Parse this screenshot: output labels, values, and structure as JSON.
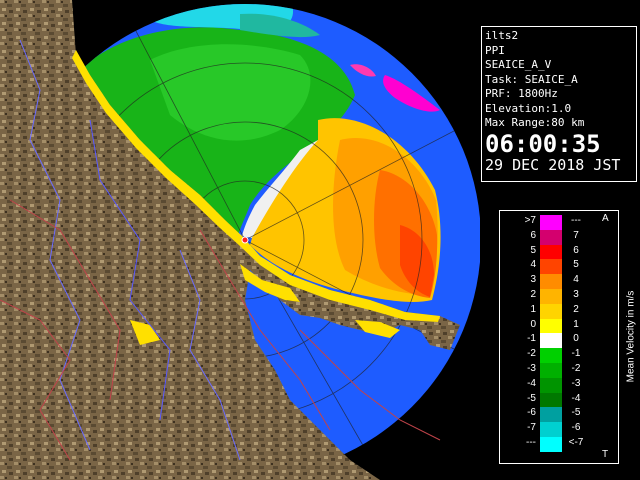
{
  "info": {
    "radar": "ilts2",
    "product": "PPI",
    "scan": "SEAICE_A_V",
    "task": "Task: SEAICE_A",
    "prf": "PRF: 1800Hz",
    "elevation": "Elevation:1.0",
    "max_range": "Max Range:80 km",
    "time": "06:00:35",
    "date": "29 DEC 2018 JST"
  },
  "legend": {
    "title": "Mean Velocity in m/s",
    "top_mark": "A",
    "bottom_mark": "T",
    "rows": [
      {
        "left": ">7",
        "right": "---",
        "color": "#ff00ff"
      },
      {
        "left": "6",
        "right": "7",
        "color": "#d4006e"
      },
      {
        "left": "5",
        "right": "6",
        "color": "#ff0000"
      },
      {
        "left": "4",
        "right": "5",
        "color": "#ff4400"
      },
      {
        "left": "3",
        "right": "4",
        "color": "#ff8c00"
      },
      {
        "left": "2",
        "right": "3",
        "color": "#ffb400"
      },
      {
        "left": "1",
        "right": "2",
        "color": "#ffd400"
      },
      {
        "left": "0",
        "right": "1",
        "color": "#ffff00"
      },
      {
        "left": "-1",
        "right": "0",
        "color": "#ffffff"
      },
      {
        "left": "-2",
        "right": "-1",
        "color": "#00d000"
      },
      {
        "left": "-3",
        "right": "-2",
        "color": "#00b000"
      },
      {
        "left": "-4",
        "right": "-3",
        "color": "#009400"
      },
      {
        "left": "-5",
        "right": "-4",
        "color": "#007800"
      },
      {
        "left": "-6",
        "right": "-5",
        "color": "#00a0a0"
      },
      {
        "left": "-7",
        "right": "-6",
        "color": "#00d0d0"
      },
      {
        "left": "---",
        "right": "<-7",
        "color": "#00ffff"
      }
    ]
  }
}
